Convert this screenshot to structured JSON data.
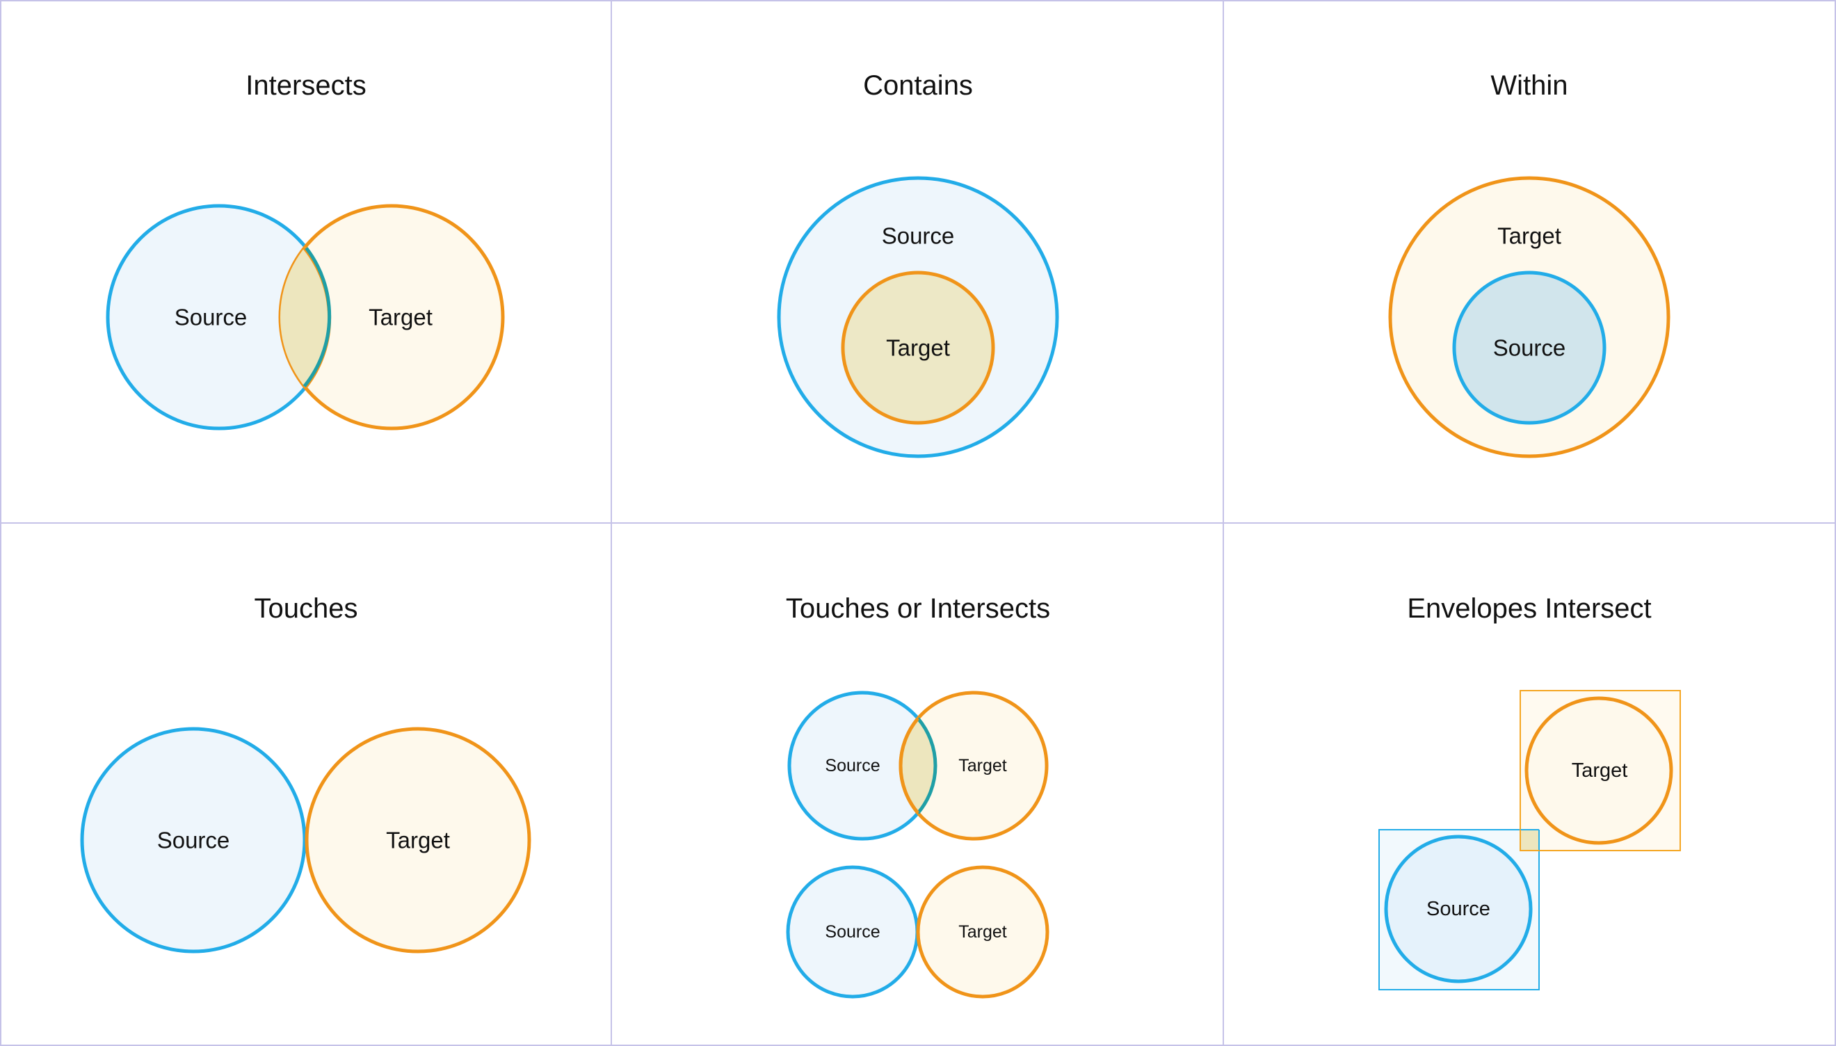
{
  "panels": {
    "intersects": {
      "title": "Intersects",
      "source": "Source",
      "target": "Target"
    },
    "contains": {
      "title": "Contains",
      "source": "Source",
      "target": "Target"
    },
    "within": {
      "title": "Within",
      "target": "Target",
      "source": "Source"
    },
    "touches": {
      "title": "Touches",
      "source": "Source",
      "target": "Target"
    },
    "touches_or_intersects": {
      "title": "Touches or Intersects",
      "top_source": "Source",
      "top_target": "Target",
      "bottom_source": "Source",
      "bottom_target": "Target"
    },
    "envelopes_intersect": {
      "title": "Envelopes Intersect",
      "target": "Target",
      "source": "Source"
    }
  },
  "colors": {
    "source_stroke": "#22ace8",
    "target_stroke": "#f09419",
    "divider": "#c5c2e8"
  }
}
